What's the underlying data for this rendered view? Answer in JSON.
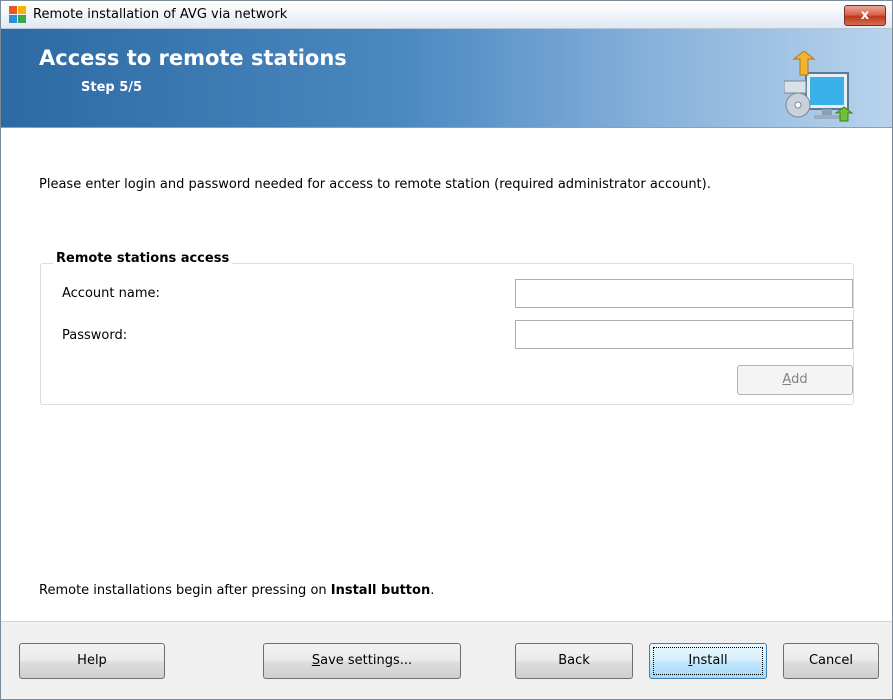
{
  "window": {
    "title": "Remote installation of AVG via network",
    "close_glyph": "x"
  },
  "banner": {
    "title": "Access to remote stations",
    "step": "Step 5/5",
    "icon": "computer-network-icon"
  },
  "intro": "Please enter login and password needed for access to remote station (required administrator account).",
  "group": {
    "title": "Remote stations access",
    "account_label": "Account name:",
    "account_value": "",
    "password_label": "Password:",
    "password_value": "",
    "add_label_first": "A",
    "add_label_rest": "dd"
  },
  "footer_note": {
    "prefix": "Remote installations begin after pressing on ",
    "bold": "Install button",
    "suffix": "."
  },
  "buttons": {
    "help": "Help",
    "save_first": "S",
    "save_rest": "ave settings...",
    "back": "Back",
    "install_first": "I",
    "install_rest": "nstall",
    "cancel": "Cancel"
  },
  "colors": {
    "banner_start": "#2d6aa3",
    "banner_end": "#b9d3ec",
    "close_button": "#c0391f"
  }
}
